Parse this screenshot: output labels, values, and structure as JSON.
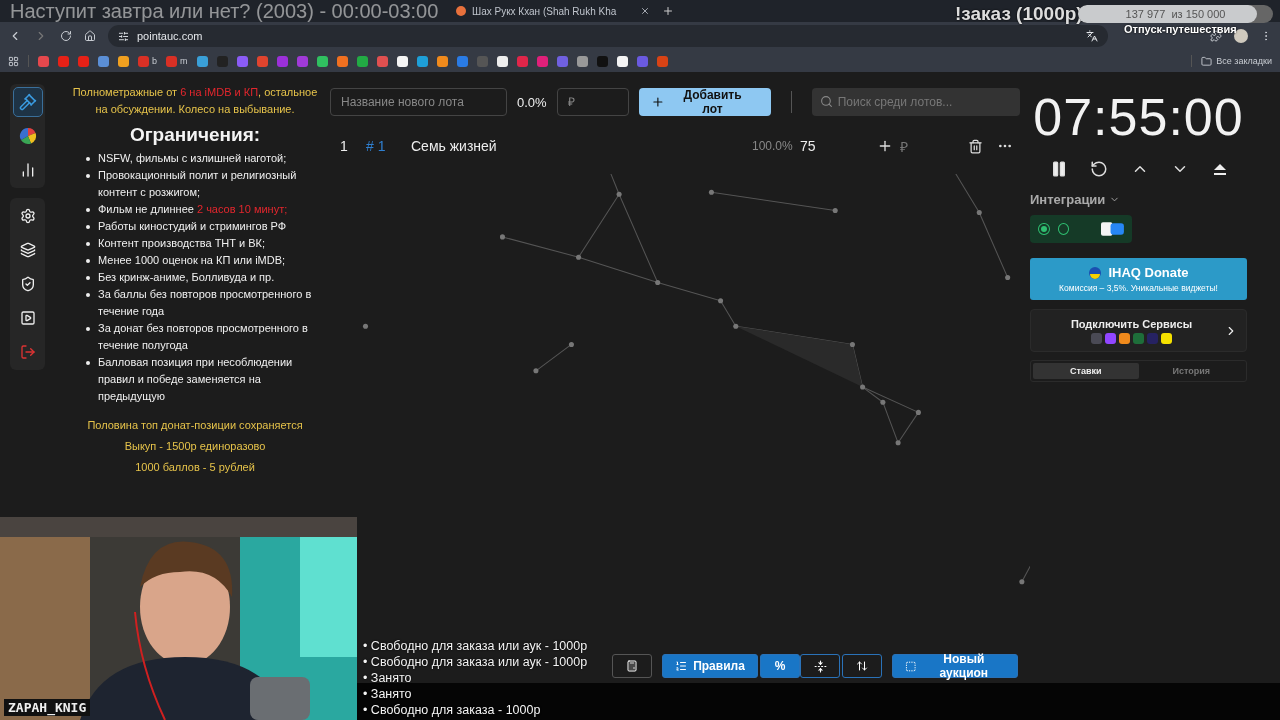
{
  "overlay_title": "Наступит завтра или нет? (2003) - 00:00-03:00",
  "browser": {
    "tabs": [
      {
        "title": "Шах Рукх Кхан (Shah Rukh Kha",
        "selected": false
      }
    ],
    "url": "pointauc.com",
    "bookmarks": [
      {
        "color": "#e5484d"
      },
      {
        "color": "#e62117"
      },
      {
        "color": "#e62117"
      },
      {
        "color": "#5b8fd6"
      },
      {
        "color": "#f0a020"
      },
      {
        "color": "#d93025",
        "label": "b"
      },
      {
        "color": "#d93025",
        "label": "m"
      },
      {
        "color": "#3aa0d8"
      },
      {
        "color": "#222222"
      },
      {
        "color": "#8b5cf6"
      },
      {
        "color": "#e0442e"
      },
      {
        "color": "#9b30d9"
      },
      {
        "color": "#a03ad8"
      },
      {
        "color": "#30c060"
      },
      {
        "color": "#f07020"
      },
      {
        "color": "#22aa44"
      },
      {
        "color": "#e05050"
      },
      {
        "color": "#f5f5f5"
      },
      {
        "color": "#1e9fd8"
      },
      {
        "color": "#f08a1c"
      },
      {
        "color": "#2a7be4"
      },
      {
        "color": "#555555"
      },
      {
        "color": "#eeeeee"
      },
      {
        "color": "#e0264a"
      },
      {
        "color": "#e0207a"
      },
      {
        "color": "#7060e0"
      },
      {
        "color": "#999999"
      },
      {
        "color": "#111111"
      },
      {
        "color": "#f4f4f4"
      },
      {
        "color": "#6a5ae0"
      },
      {
        "color": "#d84315"
      }
    ],
    "all_bookmarks": "Все закладки"
  },
  "stream_overlay": {
    "order_label": "!заказ (1000р)",
    "goal": {
      "reading": "137 977  из 150 000",
      "level": 0.92
    },
    "goal_name": "Отпуск-путешествия",
    "webcam_name": "ZAPAH_KNIG",
    "queue": [
      "• Свободно для заказа или аук - 1000р",
      "• Свободно для заказа или аук - 1000р",
      "• Занято",
      "• Занято",
      "• Свободно для заказа - 1000р"
    ]
  },
  "sidebar": {
    "groups": [
      [
        {
          "kind": "gavel",
          "selected": true
        },
        {
          "kind": "wheel",
          "selected": false
        },
        {
          "kind": "stats",
          "selected": false
        }
      ],
      [
        {
          "kind": "settings",
          "selected": false
        },
        {
          "kind": "layers",
          "selected": false
        },
        {
          "kind": "shield",
          "selected": false
        },
        {
          "kind": "video",
          "selected": false
        },
        {
          "kind": "logout",
          "selected": false
        }
      ]
    ]
  },
  "rules": {
    "intro": [
      {
        "text": "Полнометражные от "
      },
      {
        "text": "6 на iMDB и КП",
        "color": "#e3262d"
      },
      {
        "text": ", остальное на обсуждении. Колесо на выбывание."
      }
    ],
    "heading": "Ограничения:",
    "items": [
      [
        {
          "text": "NSFW, фильмы с излишней наготой;"
        }
      ],
      [
        {
          "text": "Провокационный полит и религиозный контент с розжигом;"
        }
      ],
      [
        {
          "text": "Фильм не длиннее "
        },
        {
          "text": "2 часов 10 минут;",
          "color": "#e3262d"
        }
      ],
      [
        {
          "text": "Работы киностудий и стримингов РФ"
        }
      ],
      [
        {
          "text": "Контент производства ТНТ и ВК;"
        }
      ],
      [
        {
          "text": "Менее 1000 оценок на КП или iMDB;"
        }
      ],
      [
        {
          "text": "Без кринж-аниме, Болливуда и пр."
        }
      ],
      [
        {
          "text": "За баллы без повторов просмотренного в течение года"
        }
      ],
      [
        {
          "text": "За донат без повторов просмотренного в течение полугода"
        }
      ],
      [
        {
          "text": "Балловая позиция при несоблюдении правил и победе заменяется на предыдущую"
        }
      ]
    ],
    "footer": [
      "Половина топ донат-позиции сохраняется",
      "Выкуп - 1500р единоразово",
      "1000 баллов - 5 рублей"
    ]
  },
  "lot_form": {
    "name_placeholder": "Название нового лота",
    "percent": "0.0%",
    "amount_placeholder": "₽",
    "add_button": "Добавить лот",
    "search_placeholder": "Поиск среди лотов..."
  },
  "lots": [
    {
      "index": "1",
      "id": "# 1",
      "name": "Семь жизней",
      "percent": "100.0%",
      "amount": "75",
      "currency": "₽"
    }
  ],
  "timer": {
    "time": "07:55:00"
  },
  "integrations": {
    "title": "Интеграции",
    "toggles": [
      {
        "on": true
      },
      {
        "on": false
      }
    ]
  },
  "donate_banner": {
    "title": "IHAQ Donate",
    "subtitle": "Комиссия – 3,5%. Уникальные виджеты!"
  },
  "services": {
    "title": "Подключить Сервисы"
  },
  "panel_tabs": [
    {
      "label": "Ставки",
      "selected": true
    },
    {
      "label": "История",
      "selected": false
    }
  ],
  "toolbar": {
    "rules_button": "Правила",
    "percent_button": "%",
    "new_auction_button": "Новый аукцион"
  }
}
